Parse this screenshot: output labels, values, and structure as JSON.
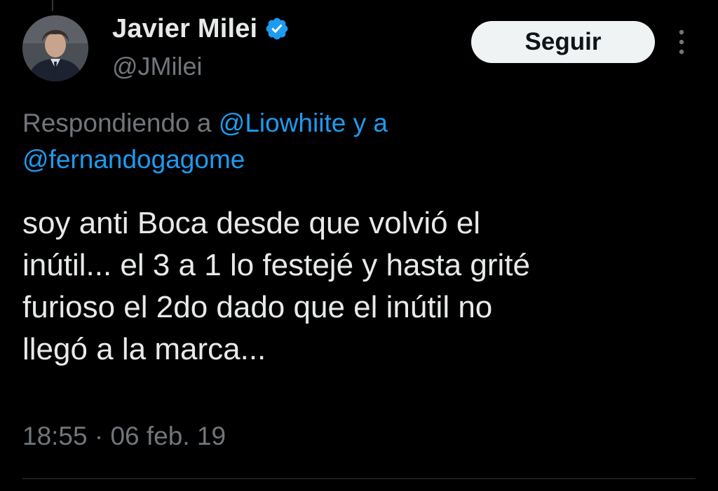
{
  "user": {
    "display_name": "Javier Milei",
    "handle": "@JMilei",
    "verified": true
  },
  "actions": {
    "follow_label": "Seguir",
    "more_icon": "more-vertical-icon"
  },
  "reply_context": {
    "prefix": "Respondiendo a ",
    "mention_1": "@Liowhiite",
    "joiner": " y a",
    "mention_2": "@fernandogagome"
  },
  "tweet": {
    "text": "soy anti Boca desde que volvió el\ninútil... el 3 a 1 lo festejé y hasta grité\nfurioso el 2do dado que el inútil no\nllegó a la marca...",
    "time": "18:55 · 06 feb. 19"
  },
  "colors": {
    "background": "#000000",
    "text": "#e7e9ea",
    "secondary_text": "#71767b",
    "link": "#1d9bf0",
    "verified_badge": "#1d9bf0",
    "button_bg": "#eff3f4"
  }
}
